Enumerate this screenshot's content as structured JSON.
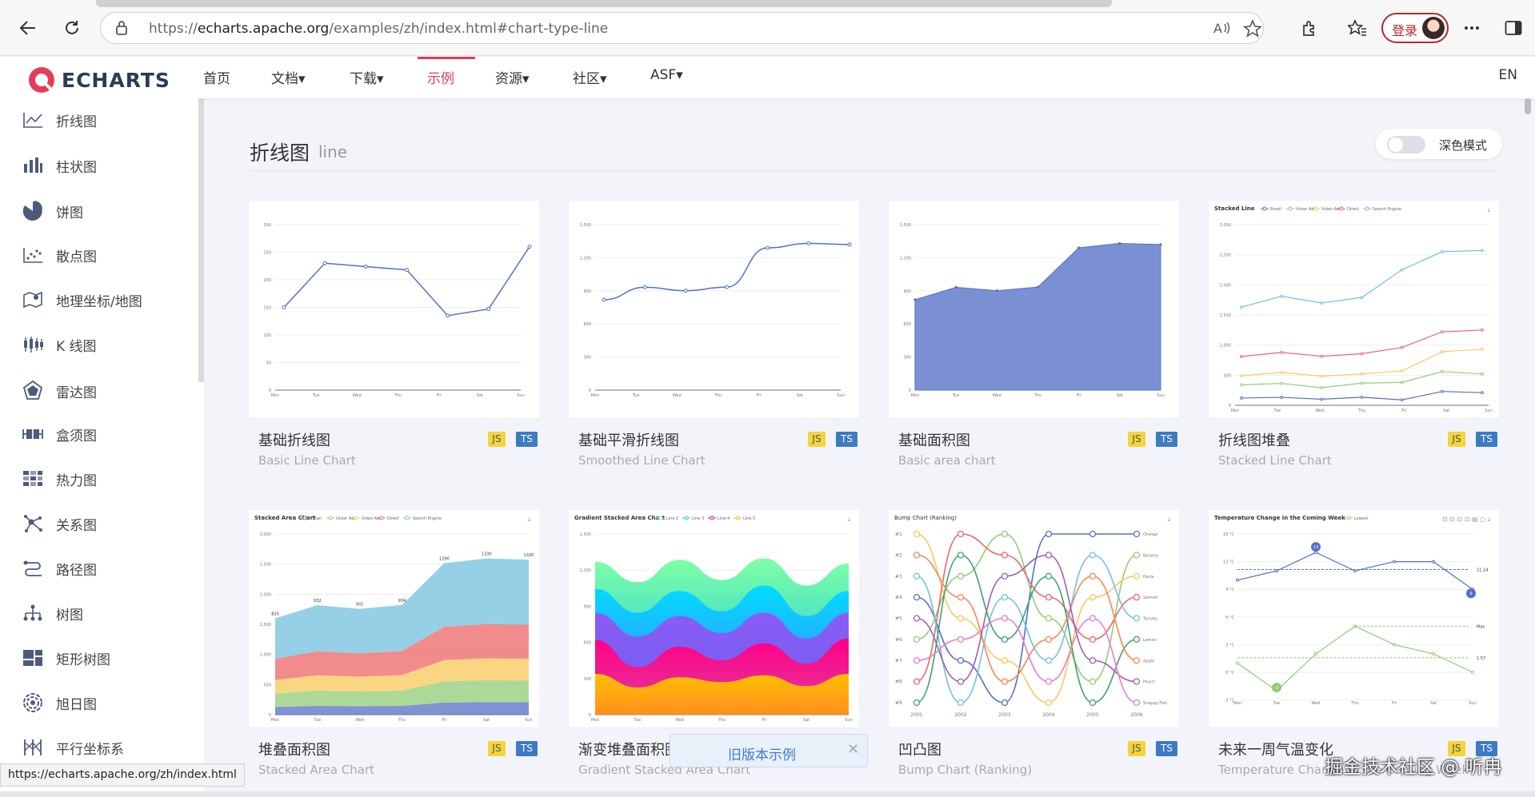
{
  "browser": {
    "url_prefix": "https://",
    "url_host": "echarts.apache.org",
    "url_rest": "/examples/zh/index.html#chart-type-line",
    "login_label": "登录",
    "status_url": "https://echarts.apache.org/zh/index.html"
  },
  "header": {
    "logo_text": "ECHARTS",
    "nav": [
      "首页",
      "文档▾",
      "下载▾",
      "示例",
      "资源▾",
      "社区▾",
      "ASF▾"
    ],
    "active_nav": "示例",
    "lang": "EN",
    "brand_color": "#e43c59"
  },
  "sidebar": {
    "items": [
      {
        "label": "折线图",
        "icon": "line-chart-icon"
      },
      {
        "label": "柱状图",
        "icon": "bar-chart-icon"
      },
      {
        "label": "饼图",
        "icon": "pie-chart-icon"
      },
      {
        "label": "散点图",
        "icon": "scatter-chart-icon"
      },
      {
        "label": "地理坐标/地图",
        "icon": "map-icon"
      },
      {
        "label": "K 线图",
        "icon": "candlestick-icon"
      },
      {
        "label": "雷达图",
        "icon": "radar-icon"
      },
      {
        "label": "盒须图",
        "icon": "boxplot-icon"
      },
      {
        "label": "热力图",
        "icon": "heatmap-icon"
      },
      {
        "label": "关系图",
        "icon": "graph-icon"
      },
      {
        "label": "路径图",
        "icon": "lines-icon"
      },
      {
        "label": "树图",
        "icon": "tree-icon"
      },
      {
        "label": "矩形树图",
        "icon": "treemap-icon"
      },
      {
        "label": "旭日图",
        "icon": "sunburst-icon"
      },
      {
        "label": "平行坐标系",
        "icon": "parallel-icon"
      }
    ]
  },
  "main": {
    "title": "折线图",
    "subtitle": "line",
    "dark_mode_label": "深色模式",
    "badges": {
      "js": "JS",
      "ts": "TS"
    }
  },
  "cards": [
    {
      "title": "基础折线图",
      "subtitle": "Basic Line Chart"
    },
    {
      "title": "基础平滑折线图",
      "subtitle": "Smoothed Line Chart"
    },
    {
      "title": "基础面积图",
      "subtitle": "Basic area chart"
    },
    {
      "title": "折线图堆叠",
      "subtitle": "Stacked Line Chart"
    },
    {
      "title": "堆叠面积图",
      "subtitle": "Stacked Area Chart"
    },
    {
      "title": "渐变堆叠面积图",
      "subtitle": "Gradient Stacked Area Chart"
    },
    {
      "title": "凹凸图",
      "subtitle": "Bump Chart (Ranking)"
    },
    {
      "title": "未来一周气温变化",
      "subtitle": "Temperature Change in the Coming Week"
    }
  ],
  "chart_data": [
    {
      "type": "line",
      "categories": [
        "Mon",
        "Tue",
        "Wed",
        "Thu",
        "Fri",
        "Sat",
        "Sun"
      ],
      "values": [
        150,
        230,
        224,
        218,
        135,
        147,
        260
      ],
      "ylim": [
        0,
        300
      ],
      "yticks": [
        0,
        50,
        100,
        150,
        200,
        250,
        300
      ]
    },
    {
      "type": "line",
      "smooth": true,
      "categories": [
        "Mon",
        "Tue",
        "Wed",
        "Thu",
        "Fri",
        "Sat",
        "Sun"
      ],
      "values": [
        820,
        932,
        901,
        934,
        1290,
        1330,
        1320
      ],
      "ylim": [
        0,
        1500
      ],
      "yticks": [
        0,
        300,
        600,
        900,
        1200,
        1500
      ]
    },
    {
      "type": "area",
      "categories": [
        "Mon",
        "Tue",
        "Wed",
        "Thu",
        "Fri",
        "Sat",
        "Sun"
      ],
      "values": [
        820,
        932,
        901,
        934,
        1290,
        1330,
        1320
      ],
      "ylim": [
        0,
        1500
      ],
      "yticks": [
        0,
        300,
        600,
        900,
        1200,
        1500
      ]
    },
    {
      "type": "line",
      "title": "Stacked Line",
      "categories": [
        "Mon",
        "Tue",
        "Wed",
        "Thu",
        "Fri",
        "Sat",
        "Sun"
      ],
      "ylim": [
        0,
        3000
      ],
      "yticks": [
        0,
        500,
        1000,
        1500,
        2000,
        2500,
        3000
      ],
      "series": [
        {
          "name": "Email",
          "values": [
            120,
            132,
            101,
            134,
            90,
            230,
            210
          ],
          "color": "#5470c6"
        },
        {
          "name": "Union Ads",
          "values": [
            340,
            364,
            292,
            368,
            380,
            560,
            520
          ],
          "color": "#91cc75"
        },
        {
          "name": "Video Ads",
          "values": [
            490,
            546,
            483,
            522,
            570,
            890,
            930
          ],
          "color": "#fac858"
        },
        {
          "name": "Direct",
          "values": [
            810,
            878,
            815,
            856,
            960,
            1220,
            1250
          ],
          "color": "#ee6666"
        },
        {
          "name": "Search Engine",
          "values": [
            1630,
            1810,
            1700,
            1790,
            2250,
            2550,
            2570
          ],
          "color": "#73c0de"
        }
      ]
    },
    {
      "type": "area",
      "title": "Stacked Area Chart",
      "categories": [
        "Mon",
        "Tue",
        "Wed",
        "Thu",
        "Fri",
        "Sat",
        "Sun"
      ],
      "ylim": [
        0,
        3000
      ],
      "yticks": [
        0,
        500,
        1000,
        1500,
        2000,
        2500,
        3000
      ],
      "series": [
        {
          "name": "Email",
          "values": [
            120,
            132,
            101,
            134,
            90,
            230,
            210
          ],
          "color": "#5470c6"
        },
        {
          "name": "Union Ads",
          "values": [
            340,
            364,
            292,
            368,
            380,
            560,
            520
          ],
          "color": "#91cc75"
        },
        {
          "name": "Video Ads",
          "values": [
            490,
            546,
            483,
            522,
            570,
            890,
            930
          ],
          "color": "#fac858"
        },
        {
          "name": "Direct",
          "values": [
            810,
            878,
            815,
            856,
            960,
            1220,
            1250
          ],
          "color": "#ee6666"
        },
        {
          "name": "Search Engine",
          "values": [
            1630,
            1810,
            1700,
            1790,
            2250,
            2550,
            2570
          ],
          "color": "#73c0de"
        }
      ],
      "data_labels": [
        820,
        932,
        901,
        934,
        1290,
        1330,
        1320
      ]
    },
    {
      "type": "area",
      "title": "Gradient Stacked Area Chart",
      "categories": [
        "Mon",
        "Tue",
        "Wed",
        "Thu",
        "Fri",
        "Sat",
        "Sun"
      ],
      "ylim": [
        0,
        1500
      ],
      "yticks": [
        0,
        300,
        600,
        900,
        1200,
        1500
      ],
      "legend": [
        "Line 2",
        "Line 3",
        "Line 4",
        "Line 5"
      ]
    },
    {
      "type": "line",
      "title": "Bump Chart (Ranking)",
      "x": [
        "2001",
        "2002",
        "2003",
        "2004",
        "2005",
        "2006"
      ],
      "ranks": [
        "#1",
        "#2",
        "#3",
        "#4",
        "#5",
        "#6",
        "#7",
        "#8",
        "#9"
      ],
      "legend": [
        "Orange",
        "Banana",
        "Pasta",
        "Salmon",
        "Tomato",
        "Lemon",
        "Apple",
        "Peach",
        "Snappy Fish"
      ]
    },
    {
      "type": "line",
      "title": "Temperature Change in the Coming Week",
      "legend": [
        "Lowest"
      ],
      "categories": [
        "Mon",
        "Tue",
        "Wed",
        "Thu",
        "Fri",
        "Sat",
        "Sun"
      ],
      "yticks": [
        "-3 °C",
        "0 °C",
        "3 °C",
        "6 °C",
        "9 °C",
        "12 °C",
        "15 °C"
      ],
      "series": [
        {
          "name": "Highest",
          "values": [
            10,
            11,
            13,
            11,
            12,
            12,
            9
          ],
          "color": "#5470c6"
        },
        {
          "name": "Lowest",
          "values": [
            1,
            -2,
            2,
            5,
            3,
            2,
            0
          ],
          "color": "#91cc75"
        }
      ],
      "mark_labels": [
        "13",
        "9",
        "-2",
        "11.14",
        "Max",
        "1.57"
      ]
    }
  ]
}
